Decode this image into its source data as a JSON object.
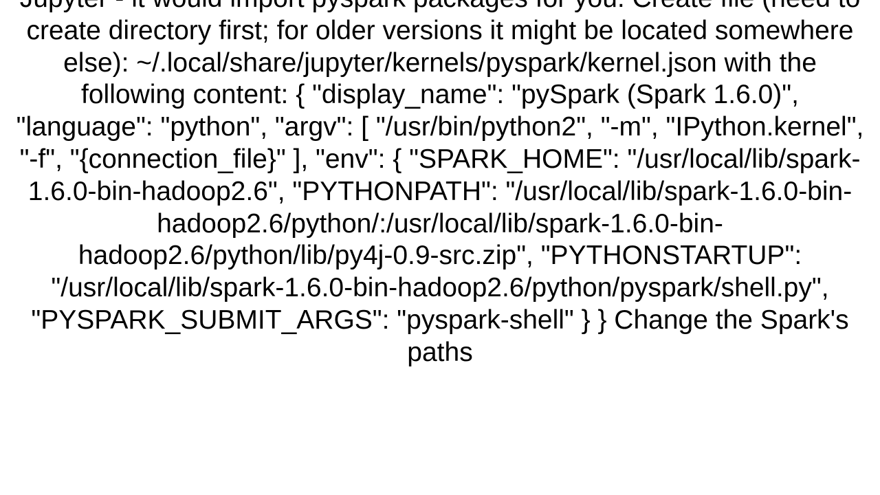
{
  "body_text": "Jupyter - it would import pyspark packages for you. Create file (need to create directory first; for older versions it might be located somewhere else): ~/.local/share/jupyter/kernels/pyspark/kernel.json  with the following content: {  \"display_name\": \"pySpark (Spark 1.6.0)\",  \"language\": \"python\",  \"argv\": [   \"/usr/bin/python2\",   \"-m\",   \"IPython.kernel\",   \"-f\",   \"{connection_file}\"  ],  \"env\": {   \"SPARK_HOME\": \"/usr/local/lib/spark-1.6.0-bin-hadoop2.6\",   \"PYTHONPATH\": \"/usr/local/lib/spark-1.6.0-bin-hadoop2.6/python/:/usr/local/lib/spark-1.6.0-bin-hadoop2.6/python/lib/py4j-0.9-src.zip\",   \"PYTHONSTARTUP\": \"/usr/local/lib/spark-1.6.0-bin-hadoop2.6/python/pyspark/shell.py\",   \"PYSPARK_SUBMIT_ARGS\": \"pyspark-shell\"  } }  Change the Spark's paths"
}
